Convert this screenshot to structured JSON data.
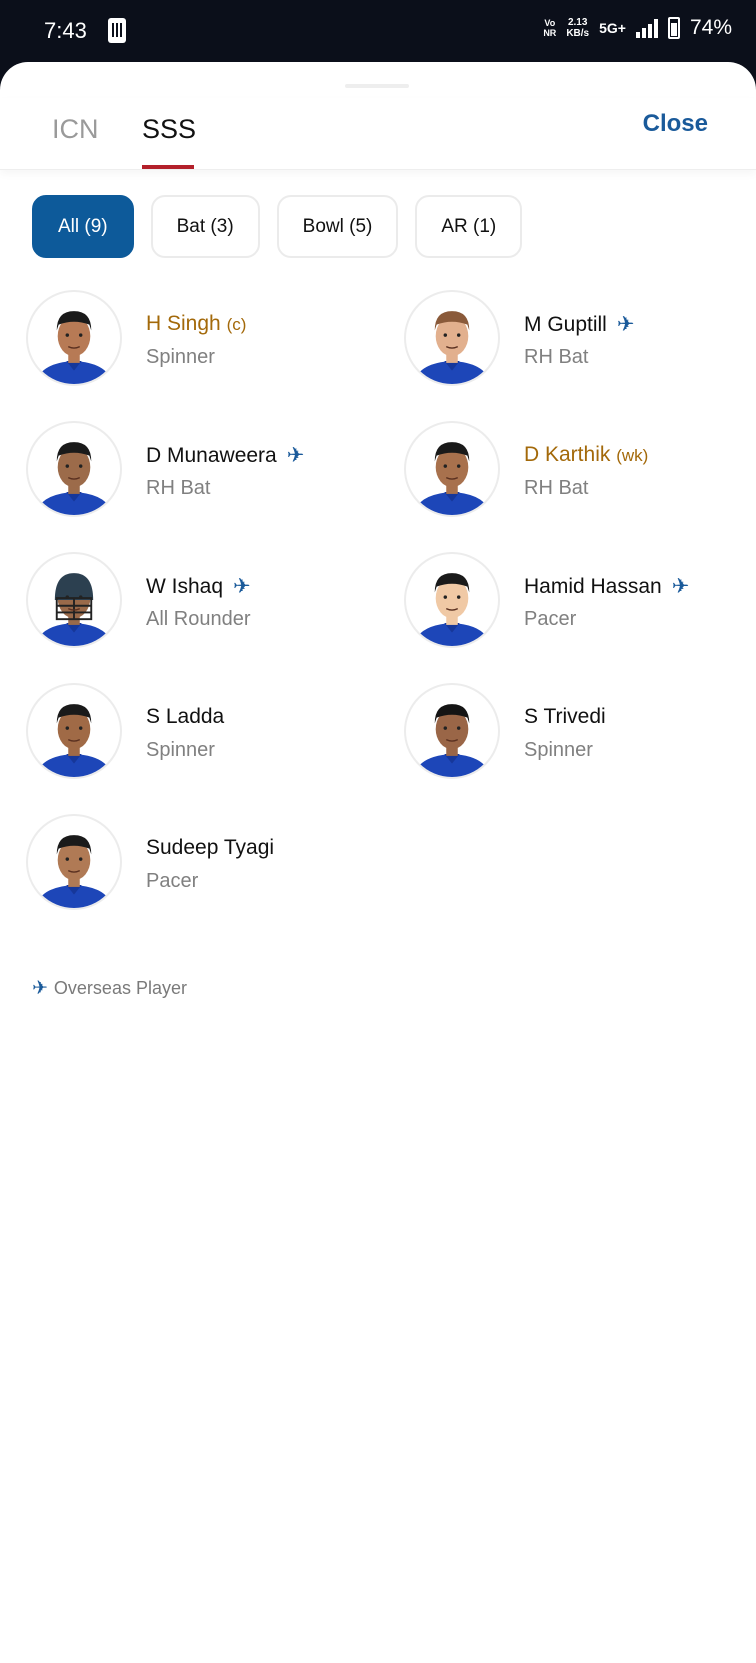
{
  "status_bar": {
    "time": "7:43",
    "vonr": [
      "Vo",
      "NR"
    ],
    "net_speed": [
      "2.13",
      "KB/s"
    ],
    "network_type": "5G+",
    "battery": "74%"
  },
  "sheet": {
    "tabs": [
      {
        "label": "ICN",
        "active": false
      },
      {
        "label": "SSS",
        "active": true
      }
    ],
    "close_label": "Close",
    "filters": [
      {
        "label": "All (9)",
        "active": true
      },
      {
        "label": "Bat (3)",
        "active": false
      },
      {
        "label": "Bowl (5)",
        "active": false
      },
      {
        "label": "AR (1)",
        "active": false
      }
    ]
  },
  "players": [
    {
      "name": "H Singh",
      "tag": "(c)",
      "role": "Spinner",
      "overseas": false,
      "highlight": true
    },
    {
      "name": "M Guptill",
      "tag": "",
      "role": "RH Bat",
      "overseas": true,
      "highlight": false
    },
    {
      "name": "D Munaweera",
      "tag": "",
      "role": "RH Bat",
      "overseas": true,
      "highlight": false
    },
    {
      "name": "D Karthik",
      "tag": "(wk)",
      "role": "RH Bat",
      "overseas": false,
      "highlight": true
    },
    {
      "name": "W Ishaq",
      "tag": "",
      "role": "All Rounder",
      "overseas": true,
      "highlight": false
    },
    {
      "name": "Hamid Hassan",
      "tag": "",
      "role": "Pacer",
      "overseas": true,
      "highlight": false
    },
    {
      "name": "S Ladda",
      "tag": "",
      "role": "Spinner",
      "overseas": false,
      "highlight": false
    },
    {
      "name": "S Trivedi",
      "tag": "",
      "role": "Spinner",
      "overseas": false,
      "highlight": false
    },
    {
      "name": "Sudeep Tyagi",
      "tag": "",
      "role": "Pacer",
      "overseas": false,
      "highlight": false
    }
  ],
  "legend": {
    "icon": "airplane-icon",
    "label": "Overseas Player"
  },
  "colors": {
    "accent_blue": "#0d5a9a",
    "captain_gold": "#a3690a",
    "tab_underline": "#b3202a"
  }
}
